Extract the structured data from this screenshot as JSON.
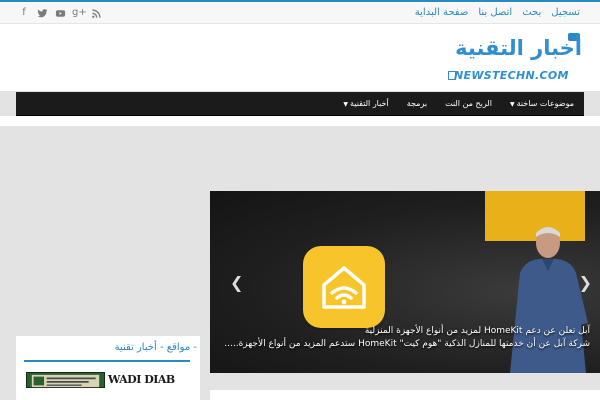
{
  "topbar": {
    "social": [
      {
        "icon": "rss-icon"
      },
      {
        "icon": "google-plus-icon",
        "glyph": "g+"
      },
      {
        "icon": "youtube-icon"
      },
      {
        "icon": "twitter-icon"
      },
      {
        "icon": "facebook-icon",
        "glyph": "f"
      }
    ],
    "links": [
      "صفحة البداية",
      "اتصل بنا",
      "بحث",
      "تسجيل"
    ]
  },
  "header": {
    "logo_ar": "أخبار التقنية",
    "logo_en": "NEWSTECHN.COM"
  },
  "nav": {
    "items": [
      {
        "label": "أخبار التقنية",
        "dropdown": true
      },
      {
        "label": "برمجة",
        "dropdown": false
      },
      {
        "label": "الربح من النت",
        "dropdown": false
      },
      {
        "label": "موضوعات ساخنة",
        "dropdown": true
      }
    ]
  },
  "slider": {
    "title": "آبل تعلن عن دعم HomeKit لمزيد من أنواع الأجهزة المنزلية",
    "excerpt": "شركة آبل عن أن خدمتها للمنازل الذكية \"هوم كيت\" HomeKit ستدعم المزيد من أنواع الأجهزة.....",
    "prev_glyph": "❮",
    "next_glyph": "❯"
  },
  "widget": {
    "title": "- مواقع - أخبار تقنية",
    "logo2_text": "WADI DIAB"
  },
  "colors": {
    "accent": "#2a89c4",
    "navbar": "#1b1b1b",
    "homekit_yellow": "#f7c42a"
  }
}
